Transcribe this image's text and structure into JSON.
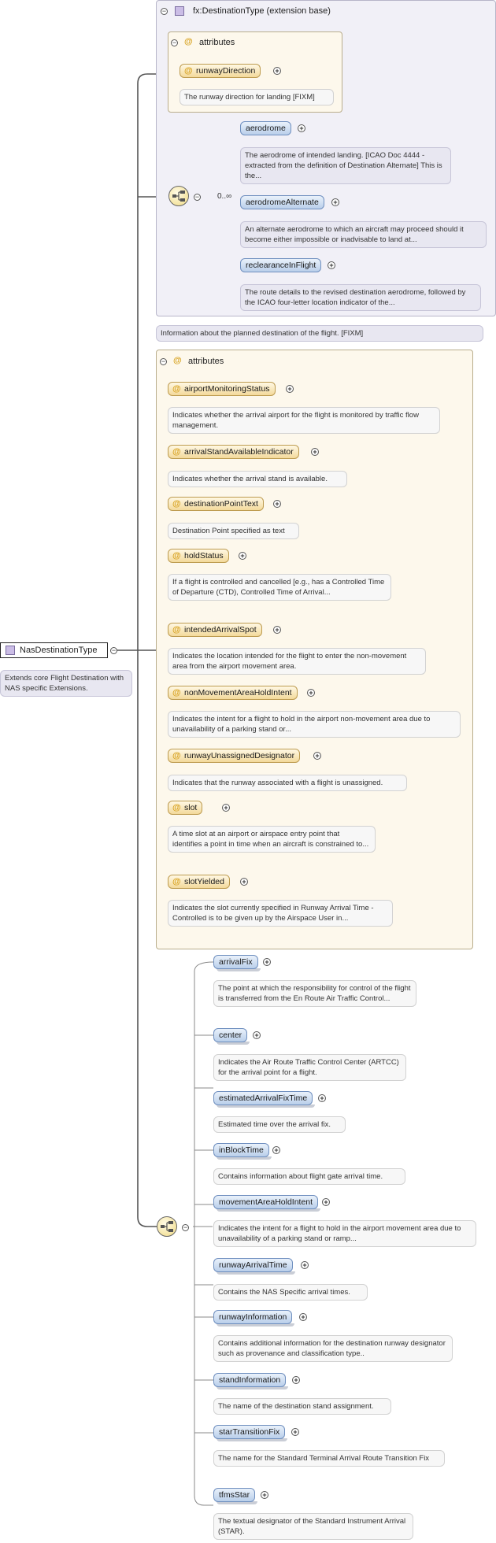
{
  "root": {
    "name": "NasDestinationType",
    "doc": "Extends core Flight Destination with NAS specific Extensions."
  },
  "extension": {
    "title": "fx:DestinationType (extension base)",
    "attributes_label": "attributes",
    "attributes": [
      {
        "name": "runwayDirection",
        "doc": "The runway direction for landing [FIXM]"
      }
    ],
    "cardinality": "0..∞",
    "elements": [
      {
        "name": "aerodrome",
        "doc": "The aerodrome of intended landing. [ICAO Doc 4444 - extracted from the definition of Destination Alternate] This is the..."
      },
      {
        "name": "aerodromeAlternate",
        "doc": "An alternate aerodrome to which an aircraft may proceed should it become either impossible or inadvisable to land at..."
      },
      {
        "name": "reclearanceInFlight",
        "doc": "The route details to the revised destination aerodrome, followed by the ICAO four-letter location indicator of the..."
      }
    ],
    "doc": "Information about the planned destination of the flight. [FIXM]"
  },
  "attributes": {
    "label": "attributes",
    "items": [
      {
        "name": "airportMonitoringStatus",
        "doc": "Indicates whether the arrival airport for the flight is monitored by traffic flow management."
      },
      {
        "name": "arrivalStandAvailableIndicator",
        "doc": "Indicates whether the arrival stand is available."
      },
      {
        "name": "destinationPointText",
        "doc": "Destination Point specified as text"
      },
      {
        "name": "holdStatus",
        "doc": "If a flight is controlled and cancelled [e.g., has a Controlled Time of Departure (CTD), Controlled Time of Arrival..."
      },
      {
        "name": "intendedArrivalSpot",
        "doc": "Indicates the location intended for the flight to enter the non-movement area from the airport movement area."
      },
      {
        "name": "nonMovementAreaHoldIntent",
        "doc": "Indicates the intent for a flight to hold in the airport non-movement area due to unavailability of a parking stand or..."
      },
      {
        "name": "runwayUnassignedDesignator",
        "doc": "Indicates that the runway associated with a flight is unassigned."
      },
      {
        "name": "slot",
        "doc": "A time slot at an airport or airspace entry point that identifies a point in time when an aircraft is constrained to..."
      },
      {
        "name": "slotYielded",
        "doc": "Indicates the slot currently specified in Runway Arrival Time - Controlled is to be given up by the Airspace User in..."
      }
    ]
  },
  "sequence": {
    "elements": [
      {
        "name": "arrivalFix",
        "doc": "The point at which the responsibility for control of the flight is transferred from the En Route Air Traffic Control..."
      },
      {
        "name": "center",
        "doc": "Indicates the Air Route Traffic Control Center (ARTCC) for the arrival point for a flight."
      },
      {
        "name": "estimatedArrivalFixTime",
        "doc": "Estimated time over the arrival fix."
      },
      {
        "name": "inBlockTime",
        "doc": "Contains information about flight gate arrival time."
      },
      {
        "name": "movementAreaHoldIntent",
        "doc": "Indicates the intent for a flight to hold in the airport movement area due to unavailability of a parking stand or ramp..."
      },
      {
        "name": "runwayArrivalTime",
        "doc": "Contains the NAS Specific arrival times."
      },
      {
        "name": "runwayInformation",
        "doc": "Contains additional information for the destination runway designator such as provenance and classification type.."
      },
      {
        "name": "standInformation",
        "doc": "The name of the destination stand assignment."
      },
      {
        "name": "starTransitionFix",
        "doc": "The name for the Standard Terminal Arrival Route Transition Fix"
      },
      {
        "name": "tfmsStar",
        "doc": "The textual designator of the Standard Instrument Arrival (STAR)."
      }
    ]
  },
  "colors": {
    "extension_panel": "#f1f0f7",
    "attribute_panel": "#fdf8ec",
    "element_node": "#b9cfea",
    "attribute_node": "#f3d99b"
  }
}
